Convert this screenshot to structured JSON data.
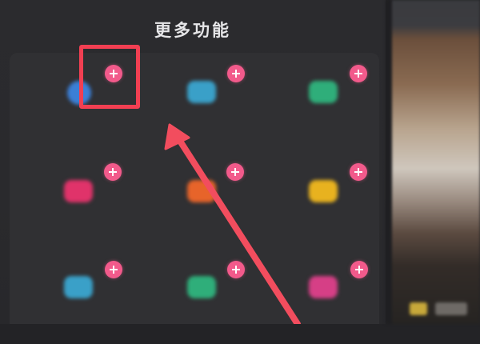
{
  "header": {
    "title": "更多功能"
  },
  "colors": {
    "accent_plus": "#f25a8b",
    "annotation_red": "#f23f52",
    "panel_bg": "#2b2b2e",
    "tile_blue": "#3b7fd6",
    "tile_cyan": "#3aa0c8",
    "tile_green": "#2fae7a",
    "tile_pink": "#e0336a",
    "tile_orange": "#e7642a",
    "tile_yellow": "#e8b21f",
    "tile_magenta": "#d63f86"
  },
  "grid": {
    "items": [
      {
        "icon": "circle-app-icon",
        "color": "#3b7fd6",
        "label": ""
      },
      {
        "icon": "square-app-icon",
        "color": "#3aa0c8",
        "label": ""
      },
      {
        "icon": "green-app-icon",
        "color": "#2fae7a",
        "label": ""
      },
      {
        "icon": "pink-app-icon",
        "color": "#e0336a",
        "label": ""
      },
      {
        "icon": "orange-app-icon",
        "color": "#e7642a",
        "label": ""
      },
      {
        "icon": "yellow-app-icon",
        "color": "#e8b21f",
        "label": ""
      },
      {
        "icon": "blue-app-icon",
        "color": "#3aa0c8",
        "label": ""
      },
      {
        "icon": "teal-app-icon",
        "color": "#2fae7a",
        "label": ""
      },
      {
        "icon": "magenta-app-icon",
        "color": "#d63f86",
        "label": ""
      }
    ]
  }
}
